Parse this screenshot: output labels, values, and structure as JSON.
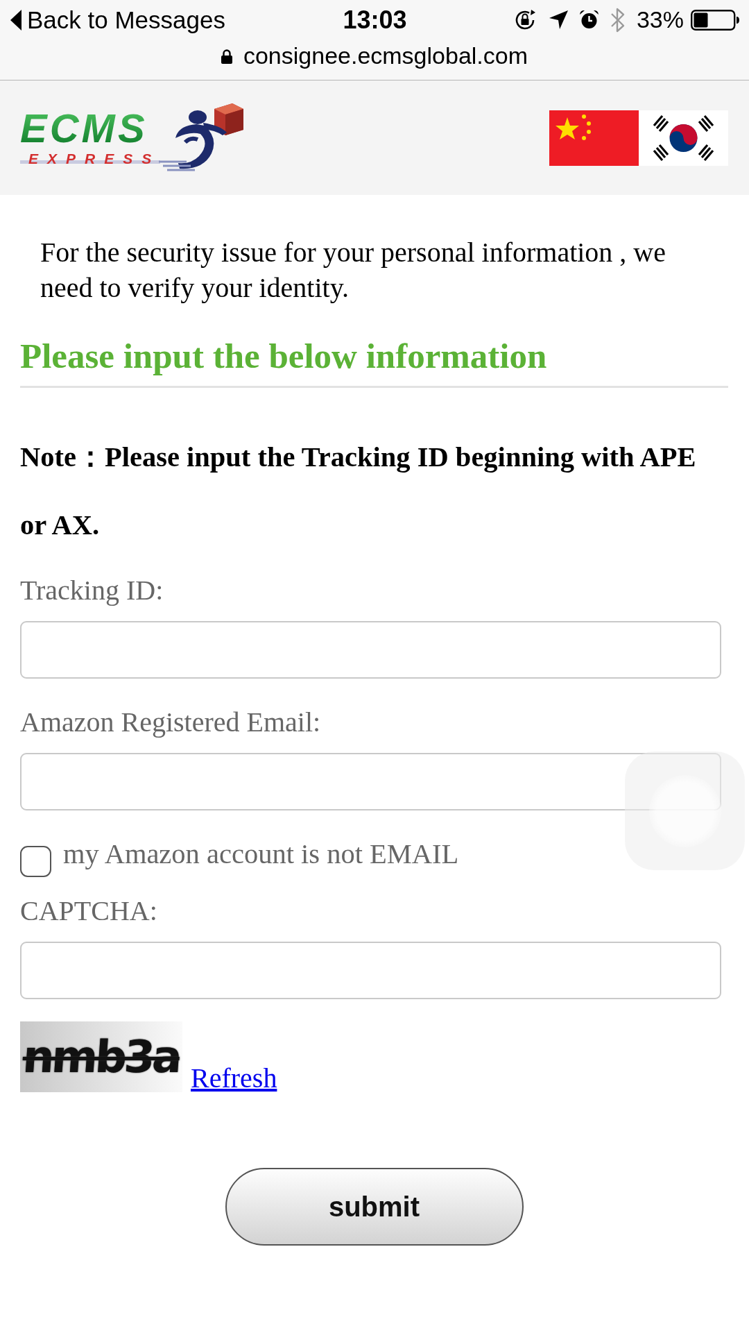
{
  "status_bar": {
    "back_label": "Back to Messages",
    "time": "13:03",
    "battery_percent": "33%"
  },
  "address_bar": {
    "url": "consignee.ecmsglobal.com"
  },
  "header": {
    "logo": {
      "wordmark": "ECMS",
      "tagline": "EXPRESS"
    }
  },
  "intro": "For the security issue for your personal information , we need to verify your identity.",
  "heading": "Please input the below information",
  "note": "Note：Please input the Tracking ID beginning with APE or AX.",
  "fields": [
    {
      "kind": "text",
      "label": "Tracking ID:"
    },
    {
      "kind": "text",
      "label": "Amazon Registered Email:"
    },
    {
      "kind": "checkbox",
      "label": "my Amazon account is not EMAIL",
      "checked": false
    },
    {
      "kind": "text",
      "label": "CAPTCHA:"
    }
  ],
  "captcha": {
    "image_text": "nmb3a",
    "refresh_link": "Refresh"
  },
  "submit_button": "submit"
}
